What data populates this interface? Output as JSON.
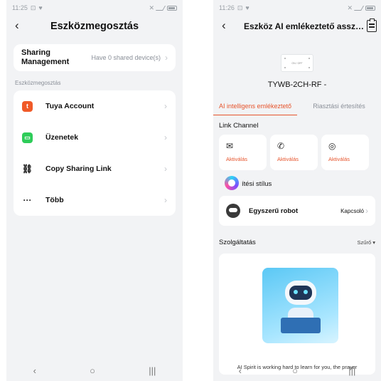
{
  "left": {
    "status": {
      "time": "11:25"
    },
    "title": "Eszközmegosztás",
    "sharing": {
      "title": "Sharing Management",
      "value": "Have 0 shared device(s)"
    },
    "section_label": "Eszközmegosztás",
    "items": [
      {
        "label": "Tuya Account",
        "icon": "tuya-icon",
        "color": "#f05a28"
      },
      {
        "label": "Üzenetek",
        "icon": "messages-icon",
        "color": "#2ecc59"
      },
      {
        "label": "Copy Sharing Link",
        "icon": "link-icon"
      },
      {
        "label": "Több",
        "icon": "more-icon"
      }
    ]
  },
  "right": {
    "status": {
      "time": "11:26"
    },
    "title": "Eszköz AI emlékeztető asszi...",
    "device_badge": "ON / OFF",
    "device_name": "TYWB-2CH-RF -",
    "tabs": [
      "AI intelligens emlékeztető",
      "Riasztási értesítés"
    ],
    "link_channel_label": "Link Channel",
    "channels": [
      {
        "icon": "mail-icon",
        "action": "Aktiválás"
      },
      {
        "icon": "phone-call-icon",
        "action": "Aktiválás"
      },
      {
        "icon": "whatsapp-icon",
        "action": "Aktiválás"
      }
    ],
    "style_label": "ítési stílus",
    "robot": {
      "name": "Egyszerű robot",
      "value": "Kapcsoló"
    },
    "services_label": "Szolgáltatás",
    "filter_label": "Szűrő",
    "ai_text": "AI Spirit is working hard to learn for you, the prayer"
  },
  "colors": {
    "accent": "#e6542c",
    "background": "#f2f3f5"
  }
}
